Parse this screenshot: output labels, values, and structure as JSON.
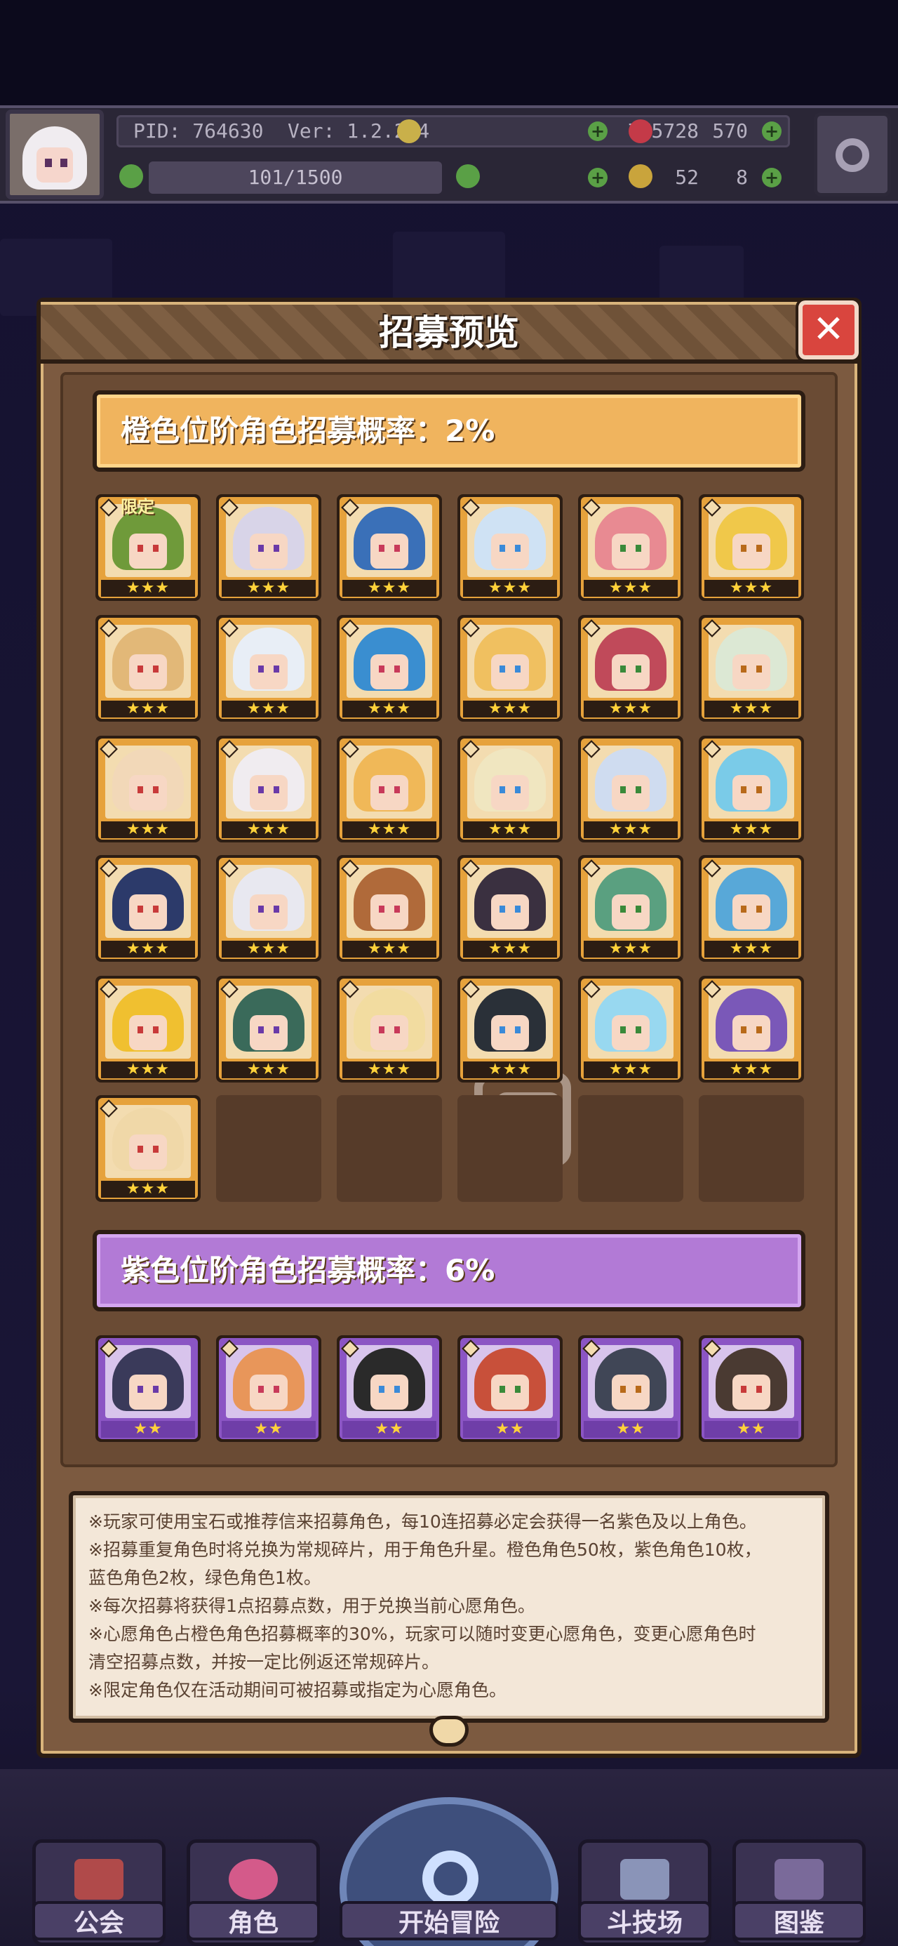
{
  "topbar": {
    "pid": "PID: 764630",
    "version": "Ver: 1.2.2.4",
    "gold": "775728",
    "gems": "570",
    "stamina": "101/1500",
    "clover": "52",
    "keys": "8"
  },
  "dialog": {
    "title": "招募预览",
    "close_label": "✕",
    "orange_header": "橙色位阶角色招募概率：2%",
    "purple_header": "紫色位阶角色招募概率：6%",
    "limited_tag": "限定",
    "orange_stars": "★★★",
    "purple_stars": "★★"
  },
  "notes": [
    "※玩家可使用宝石或推荐信来招募角色，每10连招募必定会获得一名紫色及以上角色。",
    "※招募重复角色时将兑换为常规碎片，用于角色升星。橙色角色50枚，紫色角色10枚，",
    "蓝色角色2枚，绿色角色1枚。",
    "※每次招募将获得1点招募点数，用于兑换当前心愿角色。",
    "※心愿角色占橙色角色招募概率的30%，玩家可以随时变更心愿角色，变更心愿角色时",
    "清空招募点数，并按一定比例返还常规碎片。",
    "※限定角色仅在活动期间可被招募或指定为心愿角色。"
  ],
  "bottom_nav": {
    "guild": "公会",
    "character": "角色",
    "start": "开始冒险",
    "arena": "斗技场",
    "codex": "图鉴"
  },
  "colors": {
    "orange_tier": "#f0b45e",
    "purple_tier": "#b27ad6",
    "close": "#d9453e"
  }
}
